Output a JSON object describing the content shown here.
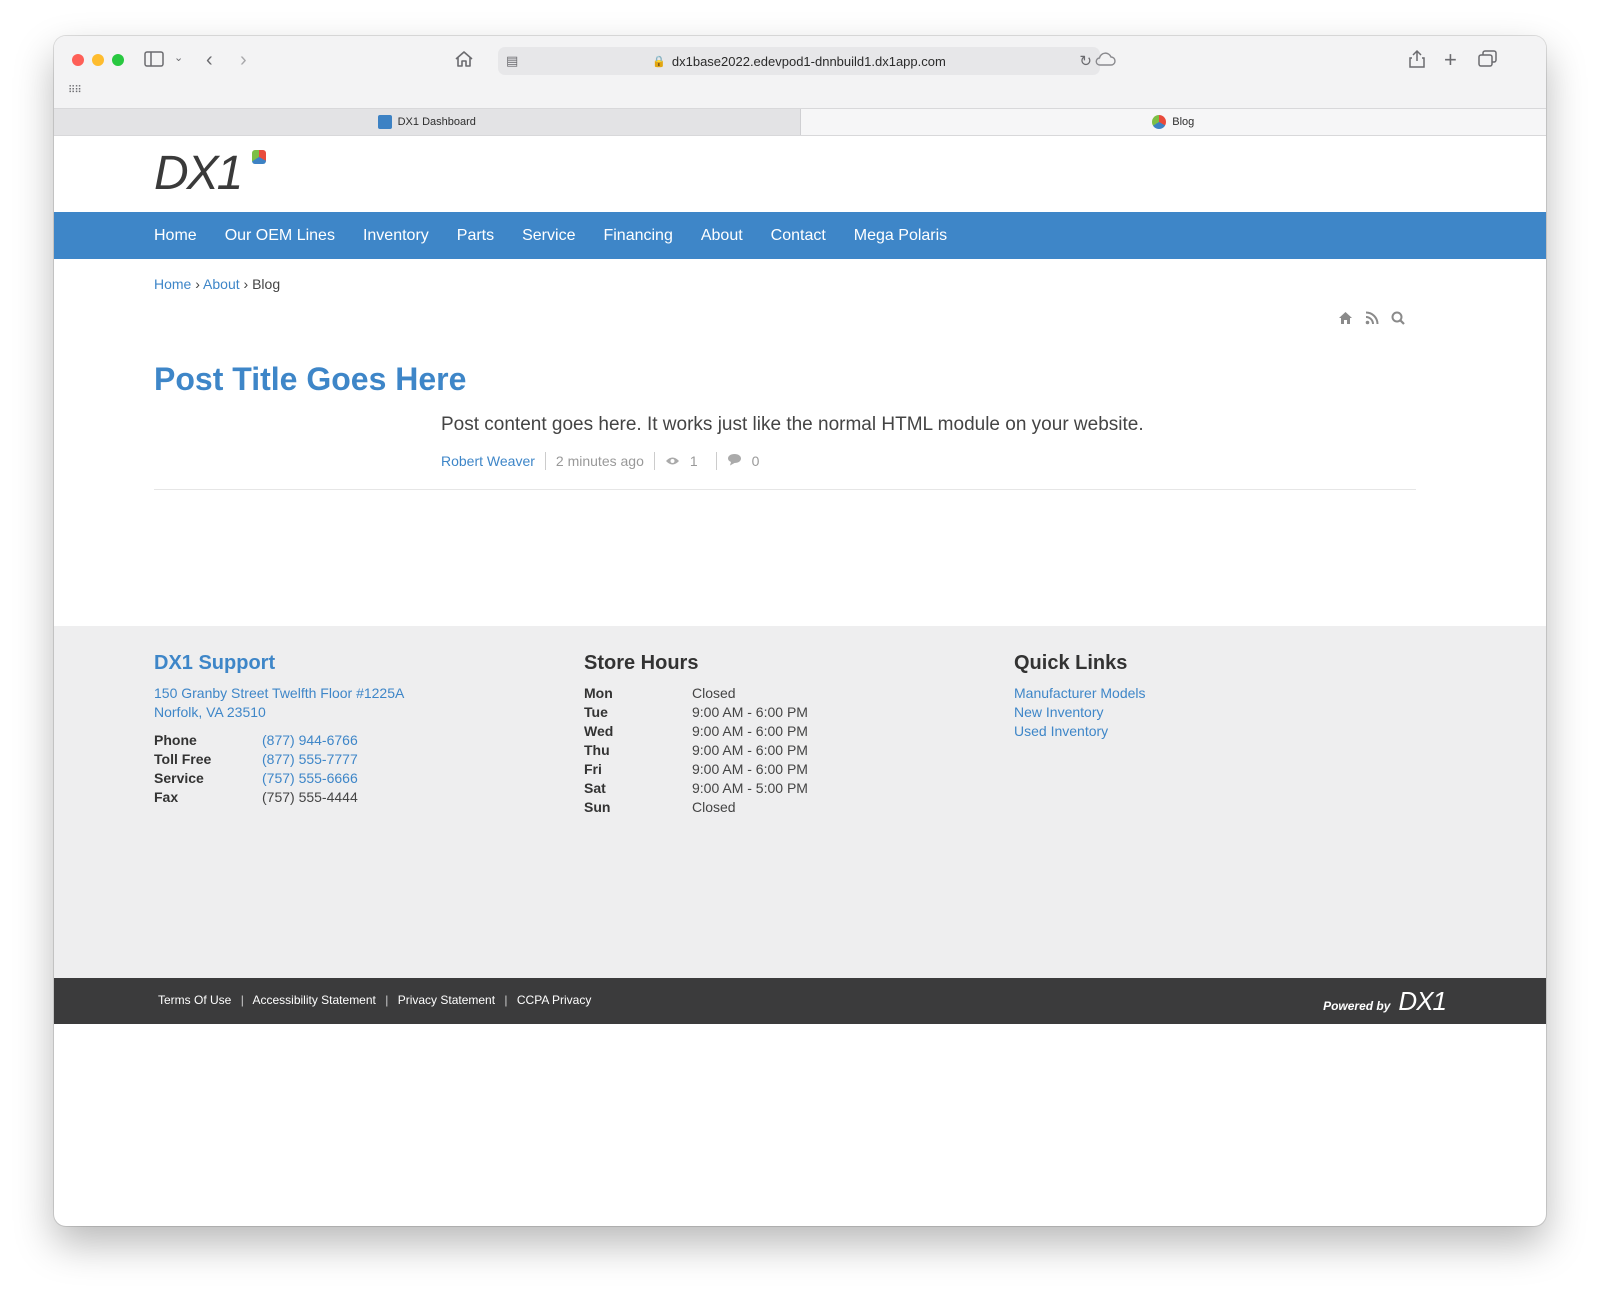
{
  "browser": {
    "url": "dx1base2022.edevpod1-dnnbuild1.dx1app.com",
    "tabs": [
      {
        "label": "DX1 Dashboard"
      },
      {
        "label": "Blog"
      }
    ]
  },
  "site": {
    "logo_text": "DX1",
    "nav": [
      {
        "label": "Home"
      },
      {
        "label": "Our OEM Lines"
      },
      {
        "label": "Inventory"
      },
      {
        "label": "Parts"
      },
      {
        "label": "Service"
      },
      {
        "label": "Financing"
      },
      {
        "label": "About"
      },
      {
        "label": "Contact"
      },
      {
        "label": "Mega Polaris"
      }
    ]
  },
  "breadcrumb": {
    "home": "Home",
    "about": "About",
    "current": "Blog",
    "sep": "›"
  },
  "post": {
    "title": "Post Title Goes Here",
    "content": "Post content goes here.  It works just like the normal HTML module on your website.",
    "author": "Robert Weaver",
    "time": "2 minutes ago",
    "views": "1",
    "comments": "0"
  },
  "footer": {
    "support": {
      "title": "DX1 Support",
      "address1": "150 Granby Street Twelfth Floor #1225A",
      "address2": "Norfolk, VA 23510",
      "contacts": [
        {
          "label": "Phone",
          "value": "(877) 944-6766"
        },
        {
          "label": "Toll Free",
          "value": "(877) 555-7777"
        },
        {
          "label": "Service",
          "value": "(757) 555-6666"
        },
        {
          "label": "Fax",
          "value": "(757) 555-4444"
        }
      ]
    },
    "hours": {
      "title": "Store Hours",
      "days": [
        {
          "day": "Mon",
          "time": "Closed"
        },
        {
          "day": "Tue",
          "time": "9:00 AM - 6:00 PM"
        },
        {
          "day": "Wed",
          "time": "9:00 AM - 6:00 PM"
        },
        {
          "day": "Thu",
          "time": "9:00 AM - 6:00 PM"
        },
        {
          "day": "Fri",
          "time": "9:00 AM - 6:00 PM"
        },
        {
          "day": "Sat",
          "time": "9:00 AM - 5:00 PM"
        },
        {
          "day": "Sun",
          "time": "Closed"
        }
      ]
    },
    "quick_links": {
      "title": "Quick Links",
      "links": [
        {
          "label": "Manufacturer Models"
        },
        {
          "label": "New Inventory"
        },
        {
          "label": "Used Inventory"
        }
      ]
    }
  },
  "bottom_bar": {
    "links": [
      {
        "label": "Terms Of Use"
      },
      {
        "label": "Accessibility Statement"
      },
      {
        "label": "Privacy Statement"
      },
      {
        "label": "CCPA Privacy"
      }
    ],
    "pipe": "|",
    "powered_by": "Powered by",
    "powered_logo": "DX1"
  },
  "colors": {
    "brand_blue": "#3e86c8",
    "footer_bg": "#eeeeef",
    "bottom_bar_bg": "#3b3b3c"
  },
  "icons": {
    "toolbar": [
      "sidebar-icon",
      "back-icon",
      "forward-icon",
      "home-icon",
      "share-icon",
      "new-tab-icon",
      "tab-overview-icon"
    ],
    "post_tools": [
      "home-icon",
      "rss-icon",
      "search-icon"
    ]
  }
}
